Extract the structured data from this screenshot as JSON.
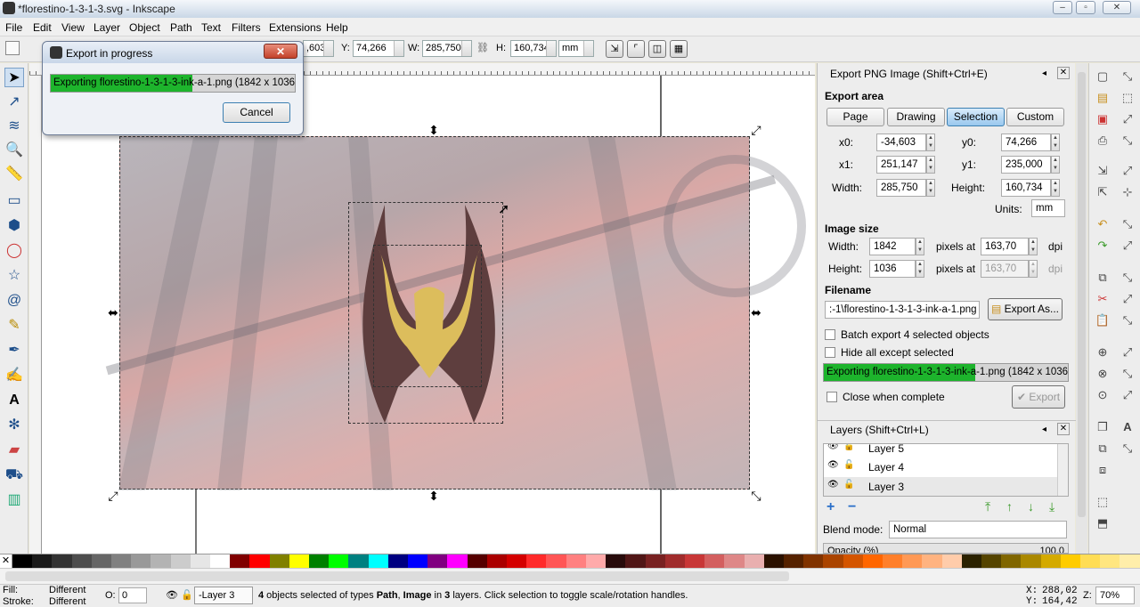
{
  "window": {
    "title": "*florestino-1-3-1-3.svg - Inkscape"
  },
  "menu": [
    "File",
    "Edit",
    "View",
    "Layer",
    "Object",
    "Path",
    "Text",
    "Filters",
    "Extensions",
    "Help"
  ],
  "toolctrl": {
    "x_value": ",603",
    "y_label": "Y:",
    "y_value": "74,266",
    "w_label": "W:",
    "w_value": "285,750",
    "h_label": "H:",
    "h_value": "160,734",
    "unit": "mm"
  },
  "progress_dialog": {
    "title": "Export in progress",
    "progress_text": "Exporting florestino-1-3-1-3-ink-a-1.png (1842 x 1036)",
    "progress_fraction": 0.58,
    "cancel": "Cancel"
  },
  "export_panel": {
    "title": "Export PNG Image (Shift+Ctrl+E)",
    "export_area": "Export area",
    "tabs": [
      "Page",
      "Drawing",
      "Selection",
      "Custom"
    ],
    "active_tab": "Selection",
    "x0_label": "x0:",
    "x0": "-34,603",
    "y0_label": "y0:",
    "y0": "74,266",
    "x1_label": "x1:",
    "x1": "251,147",
    "y1_label": "y1:",
    "y1": "235,000",
    "width_label": "Width:",
    "width": "285,750",
    "height_label": "Height:",
    "height": "160,734",
    "units_label": "Units:",
    "units": "mm",
    "image_size": "Image size",
    "img_width_label": "Width:",
    "img_width": "1842",
    "img_height_label": "Height:",
    "img_height": "1036",
    "pixels_at": "pixels at",
    "dpi1": "163,70",
    "dpi2": "163,70",
    "dpi_label": "dpi",
    "filename_label": "Filename",
    "filename": ":-1\\florestino-1-3-1-3-ink-a-1.png",
    "export_as": "Export As...",
    "batch": "Batch export 4 selected objects",
    "hide_all": "Hide all except selected",
    "progress_text": "Exporting florestino-1-3-1-3-ink-a-1.png (1842 x 1036)",
    "progress_fraction": 0.62,
    "close_when": "Close when complete",
    "export": "Export"
  },
  "layers_panel": {
    "title": "Layers (Shift+Ctrl+L)",
    "layers": [
      "Layer 5",
      "Layer 4",
      "Layer 3"
    ],
    "blend_label": "Blend mode:",
    "blend": "Normal",
    "opacity_label": "Opacity (%)",
    "opacity": "100,0"
  },
  "status": {
    "fill_label": "Fill:",
    "fill": "Different",
    "stroke_label": "Stroke:",
    "stroke": "Different",
    "o_label": "O:",
    "o_value": "0",
    "layer": "-Layer 3",
    "message_bold1": "4",
    "message_1": " objects selected of types ",
    "message_bold2": "Path",
    "message_2": ", ",
    "message_bold3": "Image",
    "message_3": " in ",
    "message_bold4": "3",
    "message_4": " layers. Click selection to toggle scale/rotation handles.",
    "x_label": "X:",
    "x": "288,02",
    "y_label": "Y:",
    "y": "164,42",
    "z_label": "Z:",
    "zoom": "70%"
  },
  "palette": [
    "#000000",
    "#1a1a1a",
    "#333333",
    "#4d4d4d",
    "#666666",
    "#808080",
    "#999999",
    "#b3b3b3",
    "#cccccc",
    "#e6e6e6",
    "#ffffff",
    "#800000",
    "#ff0000",
    "#808000",
    "#ffff00",
    "#008000",
    "#00ff00",
    "#008080",
    "#00ffff",
    "#000080",
    "#0000ff",
    "#800080",
    "#ff00ff",
    "#550000",
    "#aa0000",
    "#d40000",
    "#ff2a2a",
    "#ff5555",
    "#ff8080",
    "#ffaaaa",
    "#280b0b",
    "#501616",
    "#782121",
    "#a02c2c",
    "#c83737",
    "#d35f5f",
    "#de8787",
    "#e9afaf",
    "#2b1100",
    "#552200",
    "#803300",
    "#aa4400",
    "#d45500",
    "#ff6600",
    "#ff7f2a",
    "#ff9955",
    "#ffb380",
    "#ffccaa",
    "#2b2200",
    "#554400",
    "#806600",
    "#aa8800",
    "#d4aa00",
    "#ffcc00",
    "#ffdd55",
    "#ffe680",
    "#ffeeaa"
  ]
}
